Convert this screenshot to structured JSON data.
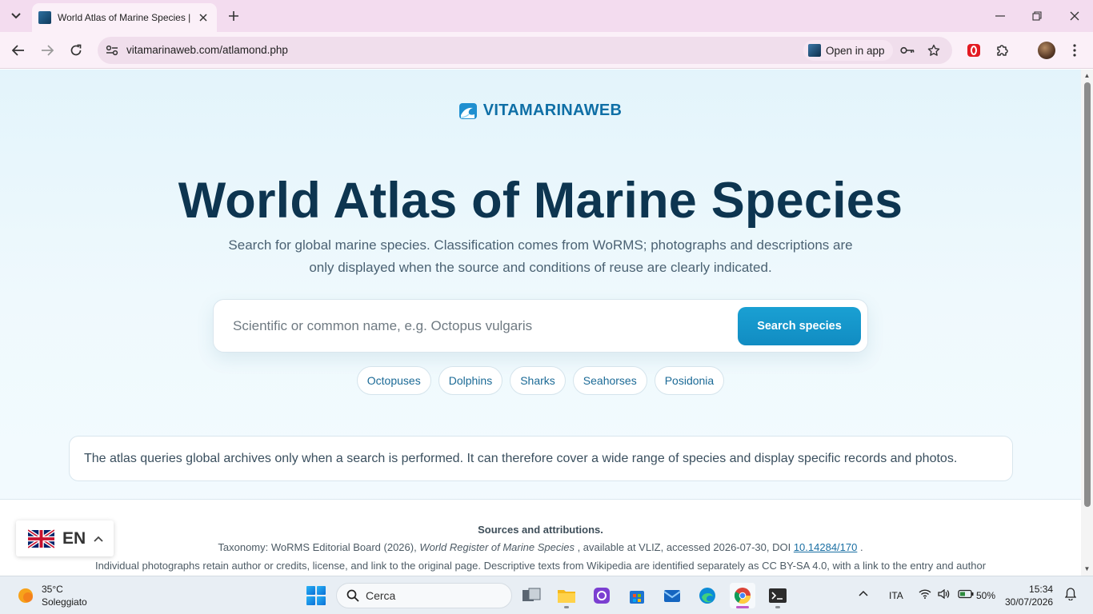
{
  "browser": {
    "tab_title": "World Atlas of Marine Species | ",
    "url": "vitamarinaweb.com/atlamond.php",
    "open_in_app_label": "Open in app"
  },
  "page": {
    "brand_name": "VITAMARINAWEB",
    "hero_title": "World Atlas of Marine Species",
    "hero_subtitle": "Search for global marine species. Classification comes from WoRMS; photographs and descriptions are only displayed when the source and conditions of reuse are clearly indicated.",
    "search": {
      "placeholder": "Scientific or common name, e.g. Octopus vulgaris",
      "button_label": "Search species"
    },
    "chips": [
      "Octopuses",
      "Dolphins",
      "Sharks",
      "Seahorses",
      "Posidonia"
    ],
    "info_text": "The atlas queries global archives only when a search is performed. It can therefore cover a wide range of species and display specific records and photos.",
    "footer": {
      "sources_title": "Sources and attributions.",
      "taxonomy_prefix": "Taxonomy: WoRMS Editorial Board (2026), ",
      "taxonomy_work": "World Register of Marine Species",
      "taxonomy_middle": " , available at VLIZ, accessed 2026-07-30, DOI ",
      "taxonomy_doi": "10.14284/170",
      "taxonomy_suffix": " .",
      "photos_line": "Individual photographs retain author or credits, license, and link to the original page. Descriptive texts from Wikipedia are identified separately as CC BY-SA 4.0, with a link to the entry and author"
    },
    "language_switcher": {
      "code": "EN"
    }
  },
  "taskbar": {
    "weather_temp": "35°C",
    "weather_desc": "Soleggiato",
    "search_label": "Cerca",
    "language": "ITA",
    "battery": "50%",
    "time": "15:34",
    "date": "30/07/2026"
  },
  "colors": {
    "brand": "#0f6fa6",
    "title": "#0d3550",
    "accent_button": "#118cc2",
    "chrome_tabbar": "#f3dcef"
  }
}
